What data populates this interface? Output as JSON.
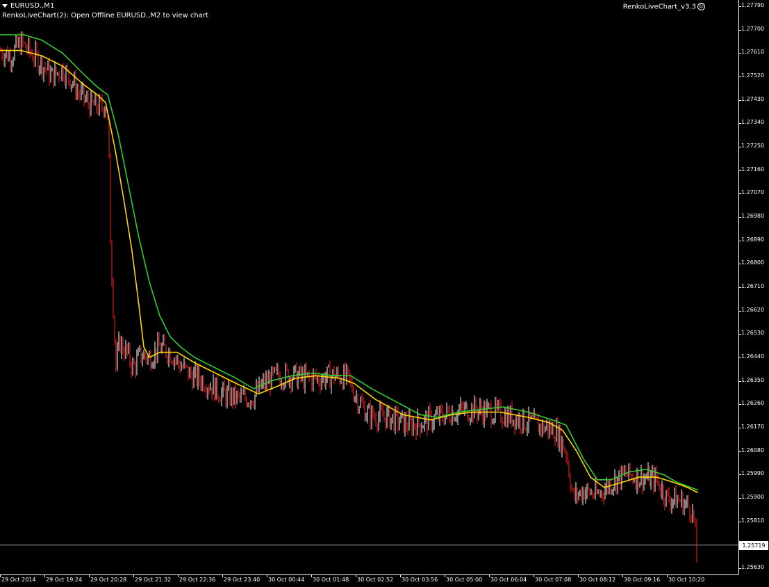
{
  "window": {
    "symbol_title": "EURUSD.,M1",
    "ea_comment": "RenkoLiveChart(2): Open Offline EURUSD.,M2 to view chart",
    "ea_name": "RenkoLiveChart_v3.3",
    "ea_smile": "☺"
  },
  "price_axis": {
    "labels": [
      "1.27790",
      "1.27700",
      "1.27610",
      "1.27520",
      "1.27430",
      "1.27340",
      "1.27250",
      "1.27160",
      "1.27070",
      "1.26980",
      "1.26890",
      "1.26800",
      "1.26710",
      "1.26620",
      "1.26530",
      "1.26440",
      "1.26350",
      "1.26260",
      "1.26170",
      "1.26080",
      "1.25990",
      "1.25900",
      "1.25810",
      "1.25630"
    ],
    "current_price": "1.25719"
  },
  "time_axis": {
    "labels": [
      "29 Oct 2014",
      "29 Oct 19:24",
      "29 Oct 20:28",
      "29 Oct 21:32",
      "29 Oct 22:36",
      "29 Oct 23:40",
      "30 Oct 00:44",
      "30 Oct 01:48",
      "30 Oct 02:52",
      "30 Oct 03:56",
      "30 Oct 05:00",
      "30 Oct 06:04",
      "30 Oct 07:08",
      "30 Oct 08:12",
      "30 Oct 09:16",
      "30 Oct 10:20"
    ]
  },
  "chart_data": {
    "type": "line",
    "symbol": "EURUSD.",
    "timeframe": "M1",
    "ylim": [
      1.2559,
      1.2783
    ],
    "grid": false,
    "price_line": 1.25719,
    "series": [
      {
        "color": "#ffffff",
        "style": "candles",
        "points": [
          [
            0,
            1.2762
          ],
          [
            15,
            1.276
          ],
          [
            30,
            1.2765
          ],
          [
            45,
            1.2761
          ],
          [
            60,
            1.2757
          ],
          [
            75,
            1.2752
          ],
          [
            90,
            1.2755
          ],
          [
            105,
            1.275
          ],
          [
            115,
            1.2745
          ],
          [
            130,
            1.2741
          ],
          [
            145,
            1.274
          ],
          [
            152,
            1.2742
          ],
          [
            156,
            1.2732
          ],
          [
            159,
            1.269
          ],
          [
            162,
            1.267
          ],
          [
            167,
            1.264
          ],
          [
            172,
            1.265
          ],
          [
            182,
            1.2646
          ],
          [
            192,
            1.264
          ],
          [
            202,
            1.2645
          ],
          [
            215,
            1.2644
          ],
          [
            230,
            1.2648
          ],
          [
            245,
            1.2646
          ],
          [
            260,
            1.2641
          ],
          [
            275,
            1.2637
          ],
          [
            295,
            1.2635
          ],
          [
            320,
            1.263
          ],
          [
            345,
            1.2628
          ],
          [
            365,
            1.2629
          ],
          [
            380,
            1.2634
          ],
          [
            400,
            1.2637
          ],
          [
            420,
            1.2637
          ],
          [
            440,
            1.2636
          ],
          [
            460,
            1.2636
          ],
          [
            480,
            1.2637
          ],
          [
            500,
            1.2636
          ],
          [
            515,
            1.2628
          ],
          [
            530,
            1.2622
          ],
          [
            560,
            1.2621
          ],
          [
            590,
            1.2618
          ],
          [
            620,
            1.262
          ],
          [
            650,
            1.2623
          ],
          [
            680,
            1.2624
          ],
          [
            710,
            1.2623
          ],
          [
            740,
            1.2621
          ],
          [
            770,
            1.2618
          ],
          [
            800,
            1.2616
          ],
          [
            815,
            1.2608
          ],
          [
            825,
            1.259
          ],
          [
            840,
            1.2593
          ],
          [
            860,
            1.2591
          ],
          [
            880,
            1.2596
          ],
          [
            900,
            1.2599
          ],
          [
            920,
            1.2598
          ],
          [
            945,
            1.2597
          ],
          [
            960,
            1.259
          ],
          [
            980,
            1.2589
          ],
          [
            995,
            1.2586
          ],
          [
            1000,
            1.258
          ],
          [
            1003,
            1.2566
          ]
        ]
      },
      {
        "color": "#ffd700",
        "style": "line",
        "points": [
          [
            0,
            1.2762
          ],
          [
            30,
            1.2762
          ],
          [
            60,
            1.276
          ],
          [
            90,
            1.2756
          ],
          [
            120,
            1.2749
          ],
          [
            140,
            1.2745
          ],
          [
            152,
            1.2742
          ],
          [
            165,
            1.2725
          ],
          [
            178,
            1.2705
          ],
          [
            190,
            1.2685
          ],
          [
            200,
            1.2664
          ],
          [
            207,
            1.2648
          ],
          [
            215,
            1.2644
          ],
          [
            230,
            1.2646
          ],
          [
            255,
            1.2646
          ],
          [
            280,
            1.2642
          ],
          [
            310,
            1.2638
          ],
          [
            340,
            1.2634
          ],
          [
            372,
            1.263
          ],
          [
            400,
            1.2633
          ],
          [
            425,
            1.2636
          ],
          [
            455,
            1.2637
          ],
          [
            490,
            1.2636
          ],
          [
            510,
            1.2634
          ],
          [
            540,
            1.2628
          ],
          [
            580,
            1.2622
          ],
          [
            620,
            1.262
          ],
          [
            650,
            1.2622
          ],
          [
            680,
            1.2623
          ],
          [
            720,
            1.2623
          ],
          [
            760,
            1.2621
          ],
          [
            790,
            1.2619
          ],
          [
            810,
            1.2616
          ],
          [
            830,
            1.2608
          ],
          [
            850,
            1.2598
          ],
          [
            870,
            1.2594
          ],
          [
            895,
            1.2596
          ],
          [
            920,
            1.2598
          ],
          [
            945,
            1.2598
          ],
          [
            970,
            1.2596
          ],
          [
            990,
            1.2594
          ],
          [
            1005,
            1.2592
          ]
        ]
      },
      {
        "color": "#32cd32",
        "style": "line",
        "points": [
          [
            0,
            1.2768
          ],
          [
            35,
            1.2768
          ],
          [
            60,
            1.2766
          ],
          [
            90,
            1.2761
          ],
          [
            120,
            1.2753
          ],
          [
            140,
            1.2748
          ],
          [
            155,
            1.2745
          ],
          [
            170,
            1.273
          ],
          [
            185,
            1.271
          ],
          [
            200,
            1.269
          ],
          [
            215,
            1.2673
          ],
          [
            230,
            1.266
          ],
          [
            245,
            1.2652
          ],
          [
            260,
            1.2648
          ],
          [
            280,
            1.2644
          ],
          [
            310,
            1.264
          ],
          [
            340,
            1.2636
          ],
          [
            365,
            1.2632
          ],
          [
            390,
            1.2635
          ],
          [
            420,
            1.2637
          ],
          [
            450,
            1.2638
          ],
          [
            480,
            1.2637
          ],
          [
            505,
            1.2637
          ],
          [
            535,
            1.2632
          ],
          [
            570,
            1.2627
          ],
          [
            605,
            1.2622
          ],
          [
            630,
            1.2621
          ],
          [
            660,
            1.2623
          ],
          [
            690,
            1.2624
          ],
          [
            725,
            1.2625
          ],
          [
            760,
            1.2623
          ],
          [
            795,
            1.262
          ],
          [
            815,
            1.2618
          ],
          [
            840,
            1.2605
          ],
          [
            860,
            1.2597
          ],
          [
            880,
            1.2597
          ],
          [
            905,
            1.26
          ],
          [
            930,
            1.2601
          ],
          [
            955,
            1.2599
          ],
          [
            975,
            1.2596
          ],
          [
            1005,
            1.2593
          ]
        ]
      }
    ]
  }
}
